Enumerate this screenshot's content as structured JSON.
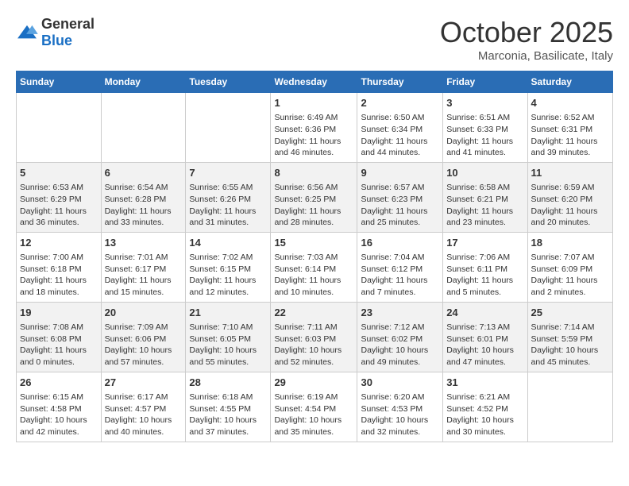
{
  "logo": {
    "general": "General",
    "blue": "Blue"
  },
  "title": "October 2025",
  "subtitle": "Marconia, Basilicate, Italy",
  "weekdays": [
    "Sunday",
    "Monday",
    "Tuesday",
    "Wednesday",
    "Thursday",
    "Friday",
    "Saturday"
  ],
  "weeks": [
    [
      {
        "day": "",
        "info": ""
      },
      {
        "day": "",
        "info": ""
      },
      {
        "day": "",
        "info": ""
      },
      {
        "day": "1",
        "info": "Sunrise: 6:49 AM\nSunset: 6:36 PM\nDaylight: 11 hours and 46 minutes."
      },
      {
        "day": "2",
        "info": "Sunrise: 6:50 AM\nSunset: 6:34 PM\nDaylight: 11 hours and 44 minutes."
      },
      {
        "day": "3",
        "info": "Sunrise: 6:51 AM\nSunset: 6:33 PM\nDaylight: 11 hours and 41 minutes."
      },
      {
        "day": "4",
        "info": "Sunrise: 6:52 AM\nSunset: 6:31 PM\nDaylight: 11 hours and 39 minutes."
      }
    ],
    [
      {
        "day": "5",
        "info": "Sunrise: 6:53 AM\nSunset: 6:29 PM\nDaylight: 11 hours and 36 minutes."
      },
      {
        "day": "6",
        "info": "Sunrise: 6:54 AM\nSunset: 6:28 PM\nDaylight: 11 hours and 33 minutes."
      },
      {
        "day": "7",
        "info": "Sunrise: 6:55 AM\nSunset: 6:26 PM\nDaylight: 11 hours and 31 minutes."
      },
      {
        "day": "8",
        "info": "Sunrise: 6:56 AM\nSunset: 6:25 PM\nDaylight: 11 hours and 28 minutes."
      },
      {
        "day": "9",
        "info": "Sunrise: 6:57 AM\nSunset: 6:23 PM\nDaylight: 11 hours and 25 minutes."
      },
      {
        "day": "10",
        "info": "Sunrise: 6:58 AM\nSunset: 6:21 PM\nDaylight: 11 hours and 23 minutes."
      },
      {
        "day": "11",
        "info": "Sunrise: 6:59 AM\nSunset: 6:20 PM\nDaylight: 11 hours and 20 minutes."
      }
    ],
    [
      {
        "day": "12",
        "info": "Sunrise: 7:00 AM\nSunset: 6:18 PM\nDaylight: 11 hours and 18 minutes."
      },
      {
        "day": "13",
        "info": "Sunrise: 7:01 AM\nSunset: 6:17 PM\nDaylight: 11 hours and 15 minutes."
      },
      {
        "day": "14",
        "info": "Sunrise: 7:02 AM\nSunset: 6:15 PM\nDaylight: 11 hours and 12 minutes."
      },
      {
        "day": "15",
        "info": "Sunrise: 7:03 AM\nSunset: 6:14 PM\nDaylight: 11 hours and 10 minutes."
      },
      {
        "day": "16",
        "info": "Sunrise: 7:04 AM\nSunset: 6:12 PM\nDaylight: 11 hours and 7 minutes."
      },
      {
        "day": "17",
        "info": "Sunrise: 7:06 AM\nSunset: 6:11 PM\nDaylight: 11 hours and 5 minutes."
      },
      {
        "day": "18",
        "info": "Sunrise: 7:07 AM\nSunset: 6:09 PM\nDaylight: 11 hours and 2 minutes."
      }
    ],
    [
      {
        "day": "19",
        "info": "Sunrise: 7:08 AM\nSunset: 6:08 PM\nDaylight: 11 hours and 0 minutes."
      },
      {
        "day": "20",
        "info": "Sunrise: 7:09 AM\nSunset: 6:06 PM\nDaylight: 10 hours and 57 minutes."
      },
      {
        "day": "21",
        "info": "Sunrise: 7:10 AM\nSunset: 6:05 PM\nDaylight: 10 hours and 55 minutes."
      },
      {
        "day": "22",
        "info": "Sunrise: 7:11 AM\nSunset: 6:03 PM\nDaylight: 10 hours and 52 minutes."
      },
      {
        "day": "23",
        "info": "Sunrise: 7:12 AM\nSunset: 6:02 PM\nDaylight: 10 hours and 49 minutes."
      },
      {
        "day": "24",
        "info": "Sunrise: 7:13 AM\nSunset: 6:01 PM\nDaylight: 10 hours and 47 minutes."
      },
      {
        "day": "25",
        "info": "Sunrise: 7:14 AM\nSunset: 5:59 PM\nDaylight: 10 hours and 45 minutes."
      }
    ],
    [
      {
        "day": "26",
        "info": "Sunrise: 6:15 AM\nSunset: 4:58 PM\nDaylight: 10 hours and 42 minutes."
      },
      {
        "day": "27",
        "info": "Sunrise: 6:17 AM\nSunset: 4:57 PM\nDaylight: 10 hours and 40 minutes."
      },
      {
        "day": "28",
        "info": "Sunrise: 6:18 AM\nSunset: 4:55 PM\nDaylight: 10 hours and 37 minutes."
      },
      {
        "day": "29",
        "info": "Sunrise: 6:19 AM\nSunset: 4:54 PM\nDaylight: 10 hours and 35 minutes."
      },
      {
        "day": "30",
        "info": "Sunrise: 6:20 AM\nSunset: 4:53 PM\nDaylight: 10 hours and 32 minutes."
      },
      {
        "day": "31",
        "info": "Sunrise: 6:21 AM\nSunset: 4:52 PM\nDaylight: 10 hours and 30 minutes."
      },
      {
        "day": "",
        "info": ""
      }
    ]
  ]
}
